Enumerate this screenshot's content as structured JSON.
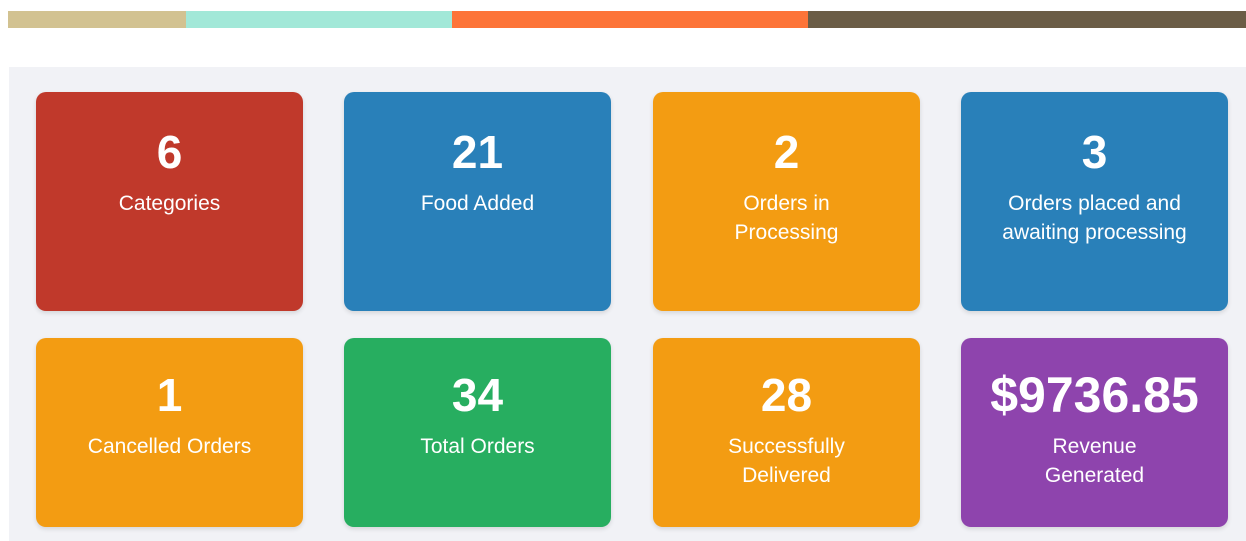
{
  "colors": {
    "strip": [
      "#d2c291",
      "#a2e8d8",
      "#fd7438",
      "#6b5d46"
    ],
    "page_background": "#f1f2f6"
  },
  "cards": [
    {
      "value": "6",
      "label": "Categories",
      "color": "#c0392b"
    },
    {
      "value": "21",
      "label": "Food Added",
      "color": "#2980b9"
    },
    {
      "value": "2",
      "label": "Orders in Processing",
      "color": "#f39c12"
    },
    {
      "value": "3",
      "label": "Orders placed and awaiting processing",
      "color": "#2980b9"
    },
    {
      "value": "1",
      "label": "Cancelled Orders",
      "color": "#f39c12"
    },
    {
      "value": "34",
      "label": "Total Orders",
      "color": "#27ae60"
    },
    {
      "value": "28",
      "label": "Successfully Delivered",
      "color": "#f39c12"
    },
    {
      "value": "$9736.85",
      "label": "Revenue Generated",
      "color": "#8e44ad"
    }
  ]
}
